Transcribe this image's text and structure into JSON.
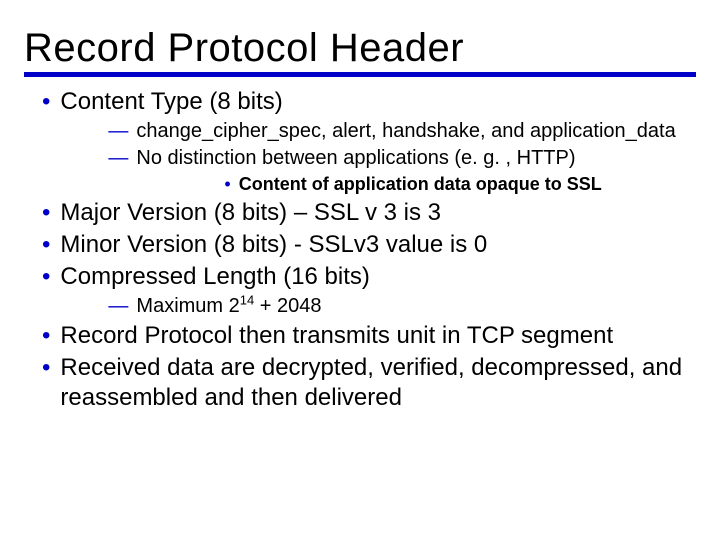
{
  "title": "Record Protocol Header",
  "bullets": {
    "b1": "Content Type (8 bits)",
    "b1_1": "change_cipher_spec, alert, handshake, and application_data",
    "b1_2": "No distinction between applications (e. g. , HTTP)",
    "b1_2_1": "Content of application data opaque to SSL",
    "b2": "Major Version (8 bits) – SSL v 3 is 3",
    "b3": "Minor Version (8 bits) - SSLv3 value is 0",
    "b4": "Compressed Length (16 bits)",
    "b4_1_prefix": "Maximum 2",
    "b4_1_sup": "14",
    "b4_1_suffix": " + 2048",
    "b5": "Record Protocol then transmits unit in TCP segment",
    "b6": "Received data are decrypted, verified, decompressed, and reassembled and then delivered"
  },
  "glyphs": {
    "bullet_l1": "•",
    "bullet_l2": "—",
    "bullet_l3": "•"
  }
}
